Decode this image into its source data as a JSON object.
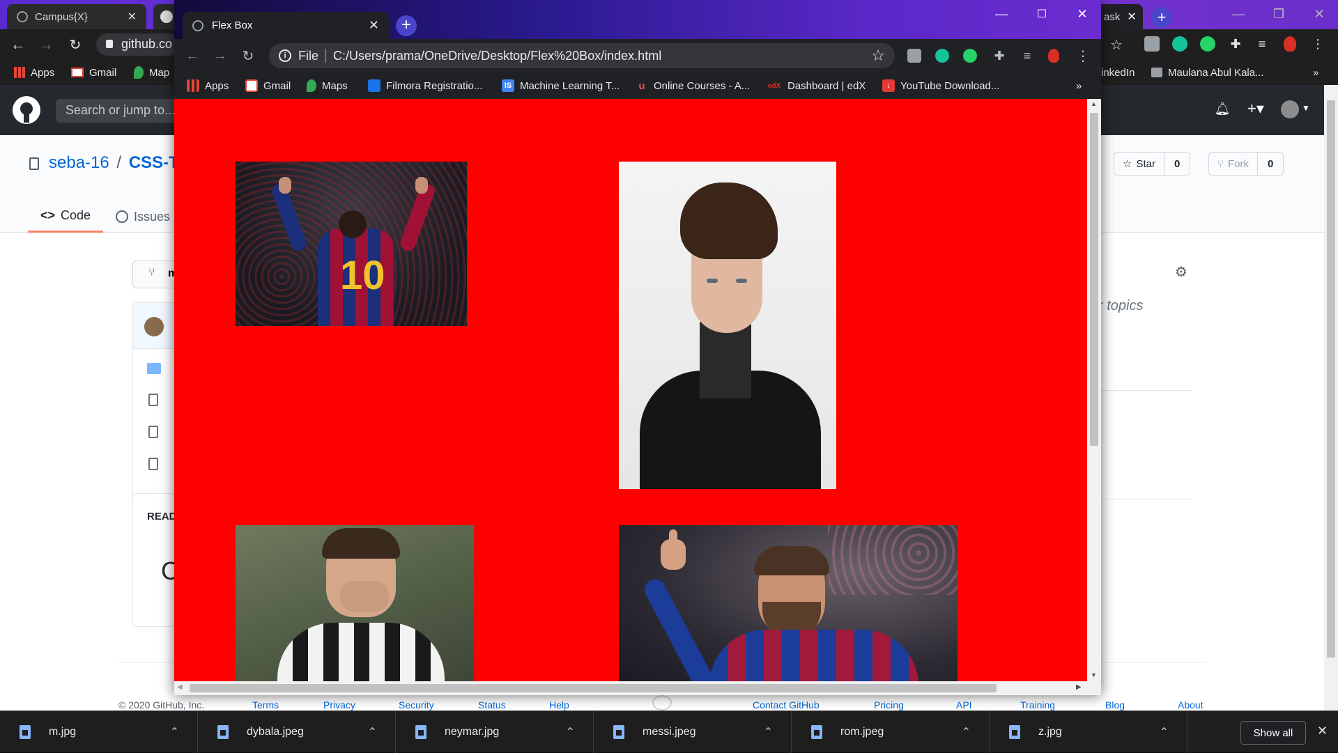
{
  "background_window": {
    "tabs": [
      {
        "title": "Campus{X}"
      },
      {
        "title": "ask"
      }
    ],
    "address": "github.co",
    "bookmarks": [
      "Apps",
      "Gmail",
      "Map",
      "inkedIn",
      "Maulana Abul Kala..."
    ],
    "search_placeholder": "Search or jump to...",
    "repo_owner": "seba-16",
    "repo_sep": "/",
    "repo_name": "CSS-Ta",
    "tabs_nav": [
      "Code",
      "Issues"
    ],
    "star_label": "Star",
    "star_count": "0",
    "fork_label": "Fork",
    "fork_count": "0",
    "topics_text": "r topics",
    "readme_label": "READ",
    "readme_big_char": "C",
    "branch_char": "m",
    "footer": [
      "© 2020 GitHub, Inc.",
      "Terms",
      "Privacy",
      "Security",
      "Status",
      "Help",
      "Contact GitHub",
      "Pricing",
      "API",
      "Training",
      "Blog",
      "About"
    ]
  },
  "foreground_window": {
    "tab_title": "Flex Box",
    "url_scheme": "File",
    "url": "C:/Users/prama/OneDrive/Desktop/Flex%20Box/index.html",
    "bookmarks": [
      "Apps",
      "Gmail",
      "Maps",
      "Filmora Registratio...",
      "Machine Learning T...",
      "Online Courses - A...",
      "Dashboard | edX",
      "YouTube Download..."
    ],
    "overflow": "»",
    "page_background": "#ff0000"
  },
  "downloads": {
    "items": [
      "m.jpg",
      "dybala.jpeg",
      "neymar.jpg",
      "messi.jpeg",
      "rom.jpeg",
      "z.jpg"
    ],
    "show_all_label": "Show all"
  },
  "colors": {
    "page_red": "#ff0000",
    "github_header": "#24292e",
    "chrome_dark": "#202124",
    "link_blue": "#0366d6"
  }
}
